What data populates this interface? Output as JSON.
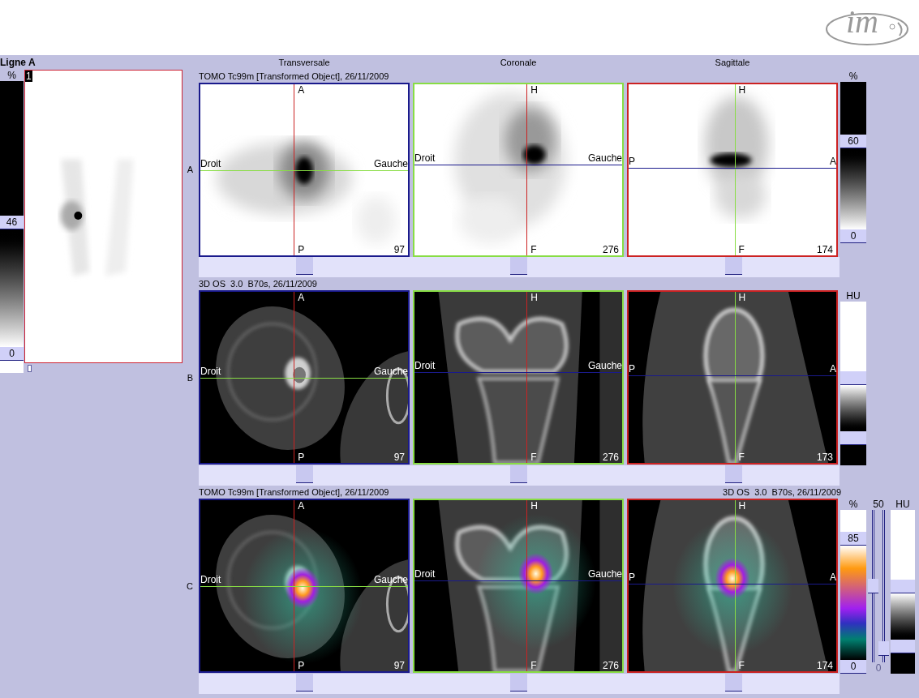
{
  "logo": {
    "text": "im"
  },
  "overview": {
    "title": "Ligne A",
    "unit": "%",
    "max": "46",
    "min": "0",
    "frame": "1"
  },
  "columns": [
    "Transversale",
    "Coronale",
    "Sagittale"
  ],
  "rows": [
    {
      "label": "A",
      "title": "TOMO Tc99m [Transformed Object], 26/11/2009",
      "kind": "spect",
      "views": [
        {
          "top": "A",
          "bottom": "P",
          "left": "Droit",
          "right": "Gauche",
          "slice": "97",
          "color": "#1a1a8c"
        },
        {
          "top": "H",
          "bottom": "F",
          "left": "Droit",
          "right": "Gauche",
          "slice": "276",
          "color": "#88dd44"
        },
        {
          "top": "H",
          "bottom": "F",
          "left": "P",
          "right": "A",
          "slice": "174",
          "color": "#cc2222"
        }
      ],
      "scale": {
        "kind": "grey",
        "unit": "%",
        "max": "60",
        "min": "0"
      }
    },
    {
      "label": "B",
      "title": "3D OS  3.0  B70s, 26/11/2009",
      "kind": "ct",
      "views": [
        {
          "top": "A",
          "bottom": "P",
          "left": "Droit",
          "right": "Gauche",
          "slice": "97",
          "color": "#1a1a8c"
        },
        {
          "top": "H",
          "bottom": "F",
          "left": "Droit",
          "right": "Gauche",
          "slice": "276",
          "color": "#88dd44"
        },
        {
          "top": "H",
          "bottom": "F",
          "left": "P",
          "right": "A",
          "slice": "173",
          "color": "#cc2222"
        }
      ],
      "scale": {
        "kind": "hu",
        "unit": "HU"
      }
    },
    {
      "label": "C",
      "title": "TOMO Tc99m [Transformed Object], 26/11/2009",
      "title_right": "3D OS  3.0  B70s, 26/11/2009",
      "kind": "fusion",
      "views": [
        {
          "top": "A",
          "bottom": "P",
          "left": "Droit",
          "right": "Gauche",
          "slice": "97",
          "color": "#1a1a8c"
        },
        {
          "top": "H",
          "bottom": "F",
          "left": "Droit",
          "right": "Gauche",
          "slice": "276",
          "color": "#88dd44"
        },
        {
          "top": "H",
          "bottom": "F",
          "left": "P",
          "right": "A",
          "slice": "174",
          "color": "#cc2222"
        }
      ],
      "scale": {
        "kind": "fusion",
        "unit": "%",
        "max": "85",
        "min": "0",
        "top_label": "50",
        "bottom_label": "0",
        "unit2": "HU",
        "sliders": [
          {
            "level": 0.5
          },
          {
            "level": 0.05
          }
        ]
      }
    }
  ]
}
